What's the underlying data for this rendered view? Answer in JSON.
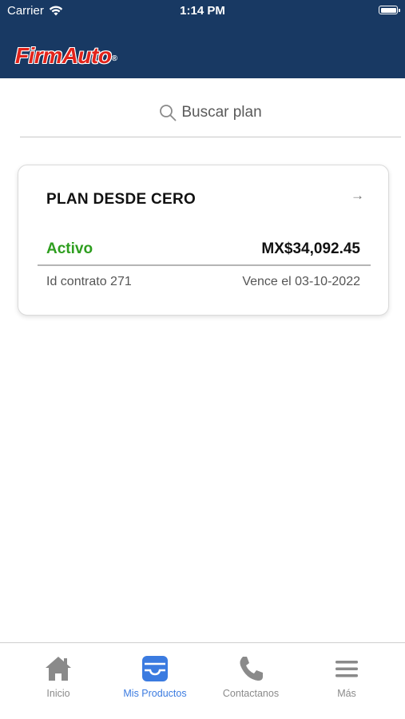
{
  "status_bar": {
    "carrier": "Carrier",
    "time": "1:14 PM"
  },
  "header": {
    "logo_firm": "Firm",
    "logo_auto": "Auto",
    "logo_reg": "®",
    "background_color": "#183963"
  },
  "search": {
    "placeholder": "Buscar plan"
  },
  "plan_card": {
    "title": "PLAN DESDE CERO",
    "arrow": "→",
    "status": "Activo",
    "status_color": "#2e9e1f",
    "amount": "MX$34,092.45",
    "contract": "Id contrato 271",
    "expiry": "Vence el 03-10-2022"
  },
  "tabbar": {
    "active_color": "#3b7be0",
    "inactive_color": "#8a8a8a",
    "tabs": [
      {
        "label": "Inicio",
        "icon": "home-icon"
      },
      {
        "label": "Mis Productos",
        "icon": "inbox-icon"
      },
      {
        "label": "Contactanos",
        "icon": "phone-icon"
      },
      {
        "label": "Más",
        "icon": "menu-icon"
      }
    ]
  }
}
